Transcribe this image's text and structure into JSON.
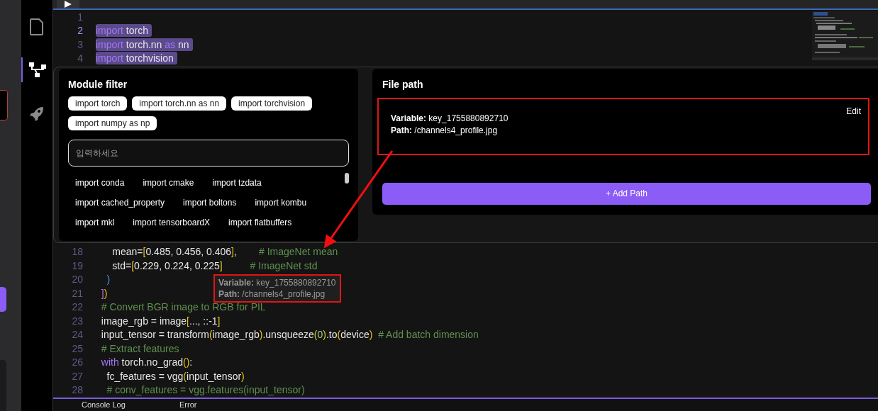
{
  "activity_bar": {
    "items": [
      {
        "kind": "file",
        "selected": false
      },
      {
        "kind": "tree",
        "selected": true
      },
      {
        "kind": "rocket",
        "selected": false
      }
    ]
  },
  "editor": {
    "code_top": [
      {
        "number": "1",
        "current": false,
        "selected": false
      },
      {
        "number": "2",
        "current": true,
        "selected": true,
        "tokens": [
          {
            "text": "import",
            "kind": "keyword"
          },
          {
            "text": " torch",
            "kind": "name"
          }
        ]
      },
      {
        "number": "3",
        "current": false,
        "selected": true,
        "tokens": [
          {
            "text": "import",
            "kind": "keyword"
          },
          {
            "text": " torch.nn ",
            "kind": "name"
          },
          {
            "text": "as",
            "kind": "keyword"
          },
          {
            "text": " nn",
            "kind": "name"
          }
        ]
      },
      {
        "number": "4",
        "current": false,
        "selected": true,
        "tokens": [
          {
            "text": "import",
            "kind": "keyword"
          },
          {
            "text": " torchvision",
            "kind": "name"
          }
        ]
      }
    ],
    "code_bottom": [
      {
        "number": "18",
        "current": false,
        "selected": false,
        "tokens": [
          {
            "text": "      mean=",
            "kind": "name"
          },
          {
            "text": "[",
            "kind": "bracket"
          },
          {
            "text": "0.485, 0.456, 0.406",
            "kind": "name"
          },
          {
            "text": "]",
            "kind": "bracket"
          },
          {
            "text": ",        ",
            "kind": "name"
          },
          {
            "text": "# ImageNet mean",
            "kind": "comment"
          }
        ]
      },
      {
        "number": "19",
        "current": false,
        "selected": false,
        "tokens": [
          {
            "text": "      std=",
            "kind": "name"
          },
          {
            "text": "[",
            "kind": "bracket"
          },
          {
            "text": "0.229, 0.224, 0.225",
            "kind": "name"
          },
          {
            "text": "]",
            "kind": "bracket"
          },
          {
            "text": "          # ImageNet std",
            "kind": "comment"
          }
        ]
      },
      {
        "number": "20",
        "current": false,
        "selected": false,
        "tokens": [
          {
            "text": "    )",
            "kind": "paren"
          }
        ]
      },
      {
        "number": "21",
        "current": false,
        "selected": false,
        "tokens": [
          {
            "text": "  ]",
            "kind": "bracket2"
          },
          {
            "text": ")",
            "kind": "bracket"
          }
        ]
      },
      {
        "number": "22",
        "current": false,
        "selected": false,
        "tokens": [
          {
            "text": "  # Convert BGR image to RGB for PIL",
            "kind": "comment"
          }
        ]
      },
      {
        "number": "23",
        "current": false,
        "selected": false,
        "tokens": [
          {
            "text": "  image_rgb = image",
            "kind": "name"
          },
          {
            "text": "[",
            "kind": "bracket"
          },
          {
            "text": "..., ::-1",
            "kind": "name"
          },
          {
            "text": "]",
            "kind": "bracket"
          }
        ]
      },
      {
        "number": "24",
        "current": false,
        "selected": false,
        "tokens": [
          {
            "text": "  input_tensor = transform",
            "kind": "name"
          },
          {
            "text": "(",
            "kind": "bracket"
          },
          {
            "text": "image_rgb",
            "kind": "name"
          },
          {
            "text": ")",
            "kind": "bracket"
          },
          {
            "text": ".unsqueeze",
            "kind": "name"
          },
          {
            "text": "(",
            "kind": "bracket"
          },
          {
            "text": "0",
            "kind": "number"
          },
          {
            "text": ")",
            "kind": "bracket"
          },
          {
            "text": ".to",
            "kind": "name"
          },
          {
            "text": "(",
            "kind": "bracket"
          },
          {
            "text": "device",
            "kind": "name"
          },
          {
            "text": ")",
            "kind": "bracket"
          },
          {
            "text": "  # Add batch dimension",
            "kind": "comment"
          }
        ]
      },
      {
        "number": "25",
        "current": false,
        "selected": false,
        "tokens": [
          {
            "text": "  # Extract features",
            "kind": "comment"
          }
        ]
      },
      {
        "number": "26",
        "current": false,
        "selected": false,
        "tokens": [
          {
            "text": "  with",
            "kind": "keyword"
          },
          {
            "text": " torch.no_grad",
            "kind": "name"
          },
          {
            "text": "()",
            "kind": "bracket"
          },
          {
            "text": ":",
            "kind": "name"
          }
        ]
      },
      {
        "number": "27",
        "current": false,
        "selected": false,
        "tokens": [
          {
            "text": "    fc_features = vgg",
            "kind": "name"
          },
          {
            "text": "(",
            "kind": "bracket"
          },
          {
            "text": "input_tensor",
            "kind": "name"
          },
          {
            "text": ")",
            "kind": "bracket"
          }
        ]
      },
      {
        "number": "28",
        "current": false,
        "selected": false,
        "tokens": [
          {
            "text": "    # conv_features = vgg.features(input_tensor)",
            "kind": "comment"
          }
        ]
      }
    ],
    "tooltip": {
      "lines": [
        "**Variable:** key_1755880892710",
        "**Path:** /channels4_profile.jpg"
      ]
    }
  },
  "module_filter": {
    "title": "Module filter",
    "chips": [
      "import torch",
      "import torch.nn as nn",
      "import torchvision",
      "import numpy as np"
    ],
    "search": {
      "placeholder": "입력하세요"
    },
    "suggestions": [
      [
        "import conda",
        "import cmake",
        "import tzdata"
      ],
      [
        "import cached_property",
        "import boltons",
        "import kombu"
      ],
      [
        "import mkl",
        "import tensorboardX",
        "import flatbuffers"
      ]
    ]
  },
  "file_path": {
    "title": "File path",
    "entries": [
      {
        "lines": [
          "**Variable:** key_1755880892710",
          "**Path:** /channels4_profile.jpg"
        ],
        "edit": "Edit"
      }
    ],
    "add_button": "+ Add Path"
  },
  "bottom_panel": {
    "tabs": [
      "Console Log",
      "Error"
    ]
  }
}
